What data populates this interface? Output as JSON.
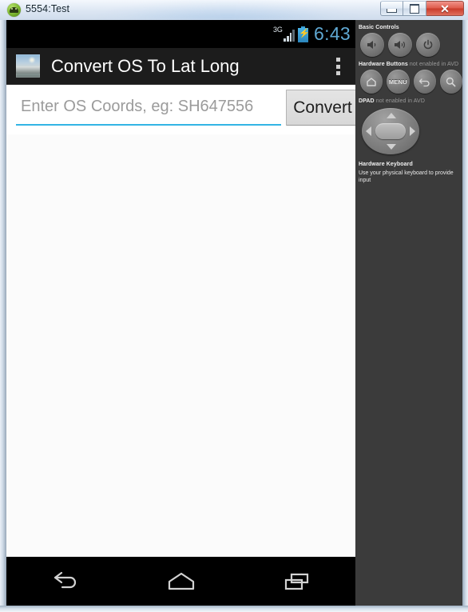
{
  "window": {
    "title": "5554:Test",
    "icon": "android-robot-icon",
    "controls": {
      "minimize": "minimize-button",
      "maximize": "maximize-button",
      "close_glyph": "✕"
    }
  },
  "device": {
    "status_bar": {
      "network_type": "3G",
      "signal_icon": "signal-bars-icon",
      "battery_icon": "battery-charging-icon",
      "clock": "6:43"
    },
    "action_bar": {
      "app_icon": "app-photo-icon",
      "title": "Convert OS To Lat Long",
      "overflow_icon": "overflow-menu-icon"
    },
    "form": {
      "input_placeholder": "Enter OS Coords, eg: SH647556",
      "input_value": "",
      "convert_label": "Convert",
      "accent_color": "#33b5e5"
    },
    "nav_bar": {
      "back": "back-icon",
      "home": "home-icon",
      "recents": "recents-icon"
    }
  },
  "control_panel": {
    "basic_controls_label": "Basic Controls",
    "basic_buttons": [
      {
        "name": "volume-down-button",
        "icon": "speaker-low-icon"
      },
      {
        "name": "volume-up-button",
        "icon": "speaker-high-icon"
      },
      {
        "name": "power-button",
        "icon": "power-icon"
      }
    ],
    "hardware_buttons_label": "Hardware Buttons",
    "hardware_buttons_note": " not enabled in AVD",
    "hardware_buttons": [
      {
        "name": "home-button",
        "icon": "home-icon",
        "label": ""
      },
      {
        "name": "menu-button",
        "icon": "text-icon",
        "label": "MENU"
      },
      {
        "name": "back-button",
        "icon": "back-arrow-icon",
        "label": ""
      },
      {
        "name": "search-button",
        "icon": "magnifier-icon",
        "label": ""
      }
    ],
    "dpad_label": "DPAD",
    "dpad_note": " not enabled in AVD",
    "keyboard_label": "Hardware Keyboard",
    "keyboard_note": "Use your physical keyboard to provide input"
  }
}
